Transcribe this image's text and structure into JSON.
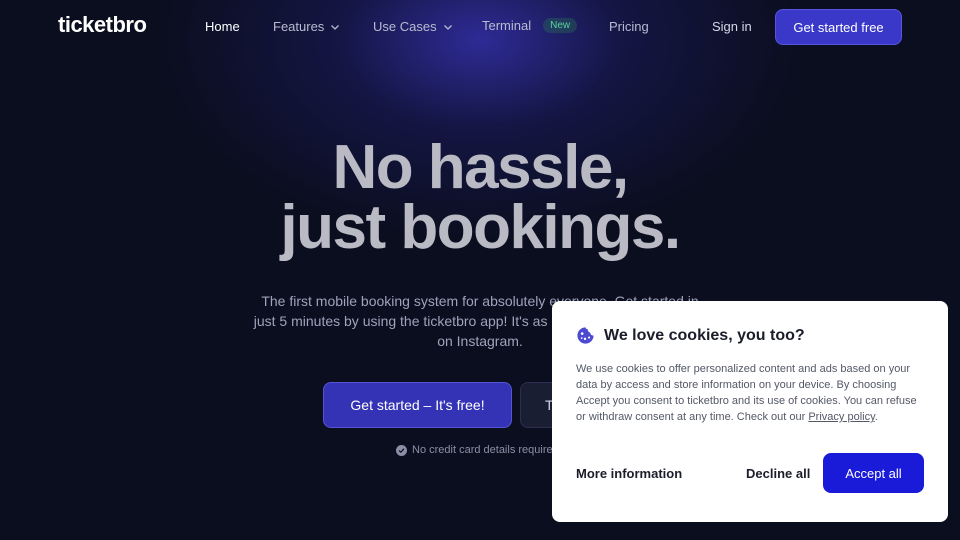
{
  "nav": {
    "logo": "ticketbro",
    "links": [
      {
        "label": "Home",
        "dropdown": false,
        "active": true
      },
      {
        "label": "Features",
        "dropdown": true
      },
      {
        "label": "Use Cases",
        "dropdown": true
      },
      {
        "label": "Terminal",
        "badge": "New"
      },
      {
        "label": "Pricing",
        "dropdown": false
      }
    ],
    "sign_in": "Sign in",
    "cta": "Get started free"
  },
  "hero": {
    "title_line1": "No hassle,",
    "title_line2": "just bookings.",
    "subtitle": "The first mobile booking system for absolutely everyone. Get started in just 5 minutes by using the ticketbro app! It's as easy as posting a picture on Instagram.",
    "primary_button": "Get started – It's free!",
    "secondary_button": "T",
    "note": "No credit card details required"
  },
  "cookie_banner": {
    "icon": "cookie-icon",
    "title": "We love cookies, you too?",
    "body": "We use cookies to offer personalized content and ads based on your data by access and store information on your device. By choosing Accept you consent to ticketbro and its use of cookies. You can refuse or withdraw consent at any time. Check out our ",
    "privacy_link": "Privacy policy",
    "body_end": ".",
    "more_info": "More information",
    "decline": "Decline all",
    "accept": "Accept all"
  },
  "colors": {
    "background": "#0b0e1f",
    "brand": "#3a38c9",
    "accept": "#1a1ad9",
    "badge_green": "#58d39a"
  }
}
